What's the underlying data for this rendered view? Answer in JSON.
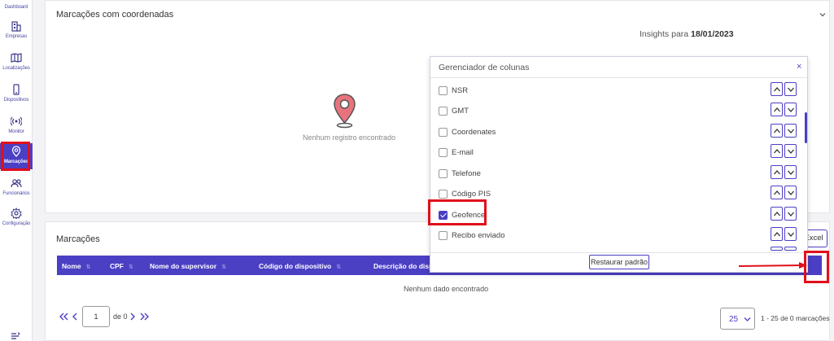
{
  "sidebar": {
    "items": [
      {
        "label": "Dashboard",
        "icon": "dashboard-icon"
      },
      {
        "label": "Empresas",
        "icon": "building-icon"
      },
      {
        "label": "Localizações",
        "icon": "map-icon"
      },
      {
        "label": "Dispositivos",
        "icon": "device-icon"
      },
      {
        "label": "Monitor",
        "icon": "broadcast-icon"
      },
      {
        "label": "Marcações",
        "icon": "pin-icon",
        "active": true
      },
      {
        "label": "Funcionários",
        "icon": "users-icon"
      },
      {
        "label": "Configuração",
        "icon": "gear-icon"
      }
    ]
  },
  "top_card": {
    "title": "Marcações com coordenadas",
    "insights_prefix": "Insights para",
    "insights_date": "18/01/2023",
    "empty_message": "Nenhum registro encontrado"
  },
  "column_manager": {
    "title": "Gerenciador de colunas",
    "close": "×",
    "columns": [
      {
        "label": "NSR",
        "checked": false
      },
      {
        "label": "GMT",
        "checked": false
      },
      {
        "label": "Coordenates",
        "checked": false
      },
      {
        "label": "E-mail",
        "checked": false
      },
      {
        "label": "Telefone",
        "checked": false
      },
      {
        "label": "Código PIS",
        "checked": false
      },
      {
        "label": "Geofence",
        "checked": true
      },
      {
        "label": "Recibo enviado",
        "checked": false
      }
    ],
    "restore_label": "Restaurar padrão"
  },
  "table_card": {
    "title": "Marcações",
    "excel_label": "Excel",
    "headers": [
      "Nome",
      "CPF",
      "Nome do supervisor",
      "Código do dispositivo",
      "Descrição do dispo"
    ],
    "empty_message": "Nenhum dado encontrado"
  },
  "pagination": {
    "current_page": "1",
    "of_label": "de 0",
    "per_page": "25",
    "range_label": "1 - 25 de 0 marcações"
  },
  "colors": {
    "accent": "#4b3fc4",
    "highlight": "#e0101a",
    "pin": "#e8737d"
  }
}
